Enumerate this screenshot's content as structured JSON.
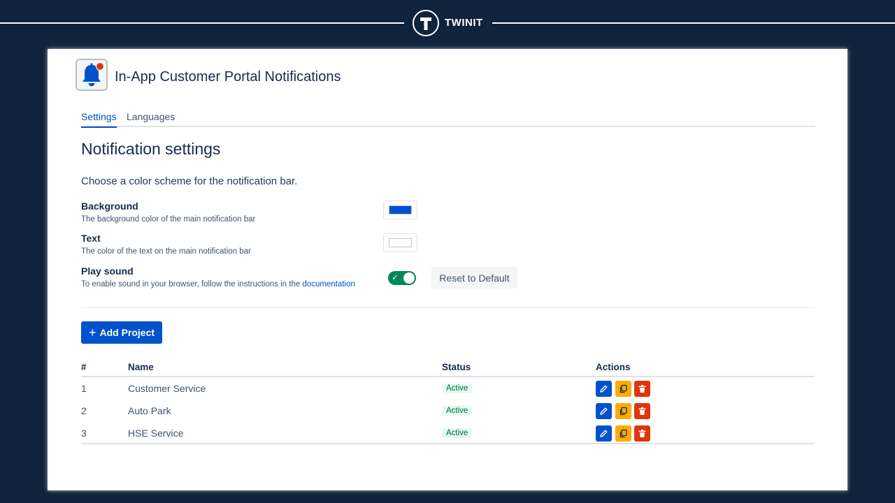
{
  "brand": {
    "name": "TWINIT"
  },
  "app": {
    "title": "In-App Customer Portal Notifications"
  },
  "tabs": [
    {
      "label": "Settings",
      "active": true
    },
    {
      "label": "Languages",
      "active": false
    }
  ],
  "section": {
    "title": "Notification settings",
    "intro": "Choose a color scheme for the notification bar."
  },
  "settings": {
    "background": {
      "label": "Background",
      "description": "The background color of the main notification bar",
      "color": "#0052cc"
    },
    "text": {
      "label": "Text",
      "description": "The color of the text on the main notification bar",
      "color": "#ffffff"
    },
    "sound": {
      "label": "Play sound",
      "description": "To enable sound in your browser, follow the instructions in the",
      "link_text": "documentation",
      "enabled": true
    },
    "reset_label": "Reset to Default"
  },
  "projects": {
    "add_label": "Add Project",
    "columns": [
      "#",
      "Name",
      "Status",
      "Actions"
    ],
    "rows": [
      {
        "num": "1",
        "name": "Customer Service",
        "status": "Active"
      },
      {
        "num": "2",
        "name": "Auto Park",
        "status": "Active"
      },
      {
        "num": "3",
        "name": "HSE Service",
        "status": "Active"
      }
    ]
  },
  "icons": {
    "brand": "twinit-logo-icon",
    "app": "bell-notification-icon",
    "edit": "pencil-icon",
    "copy": "copy-icon",
    "delete": "trash-icon",
    "add": "plus-icon",
    "toggle": "check-icon"
  },
  "colors": {
    "page_bg": "#10233d",
    "primary": "#0052cc",
    "success": "#00875a",
    "warning": "#ffab00",
    "danger": "#de350b",
    "status_bg": "#e3fcef",
    "status_text": "#006644"
  }
}
